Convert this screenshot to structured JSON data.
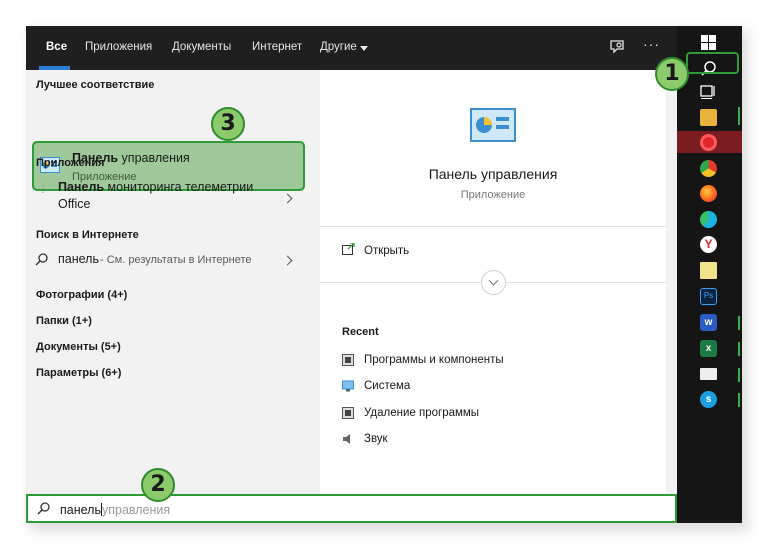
{
  "tabs": [
    "Все",
    "Приложения",
    "Документы",
    "Интернет",
    "Другие"
  ],
  "best_match": {
    "section_title": "Лучшее соответствие",
    "title_bold": "Панель",
    "title_rest": " управления",
    "subtitle": "Приложение"
  },
  "apps": {
    "section_title": "Приложения",
    "item_bold": "Панель",
    "item_rest": " мониторинга телеметрии",
    "item_line2": "Office"
  },
  "web": {
    "section_title": "Поиск в Интернете",
    "query": "панель",
    "hint": " - См. результаты в Интернете"
  },
  "categories": [
    "Фотографии (4+)",
    "Папки (1+)",
    "Документы (5+)",
    "Параметры (6+)"
  ],
  "preview": {
    "title": "Панель управления",
    "subtitle": "Приложение",
    "open_label": "Открыть",
    "recent_title": "Recent",
    "recent_items": [
      "Программы и компоненты",
      "Система",
      "Удаление программы",
      "Звук"
    ]
  },
  "search": {
    "typed": "панель",
    "completion": "управления"
  },
  "callouts": [
    "1",
    "2",
    "3"
  ],
  "colors": {
    "accent": "#2b7fd6",
    "highlight_green": "#2d9b38",
    "callout_fill": "#8bcb6c"
  }
}
